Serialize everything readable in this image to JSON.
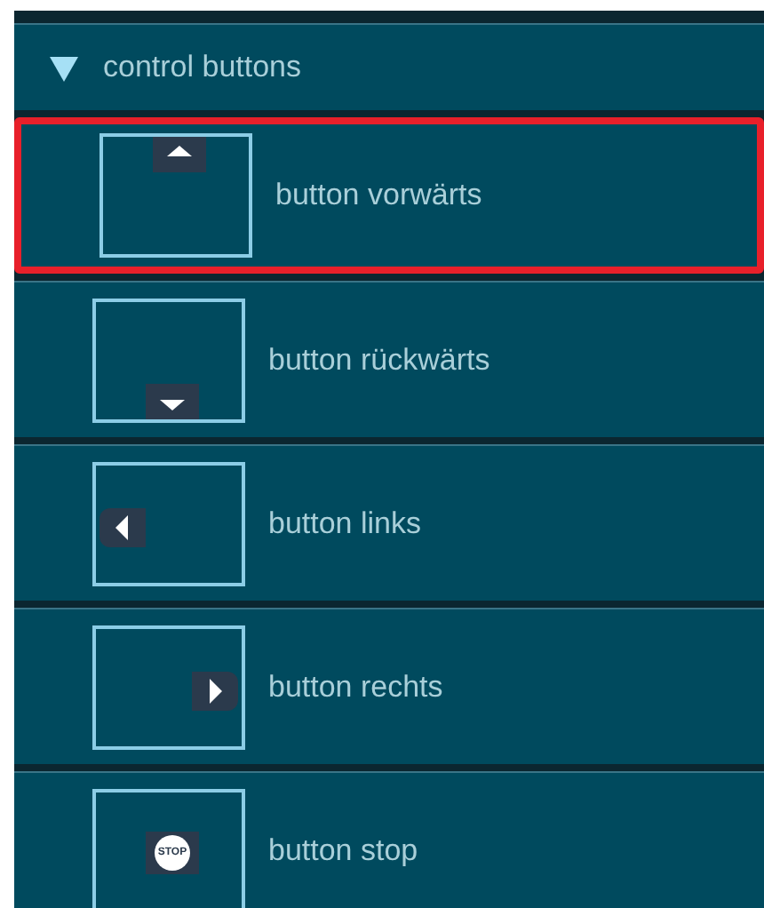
{
  "section": {
    "title": "control buttons",
    "expanded": true
  },
  "items": [
    {
      "kind": "up",
      "label": "button vorwärts",
      "selected": true
    },
    {
      "kind": "down",
      "label": "button rückwärts",
      "selected": false
    },
    {
      "kind": "left",
      "label": "button links",
      "selected": false
    },
    {
      "kind": "right",
      "label": "button rechts",
      "selected": false
    },
    {
      "kind": "stop",
      "label": "button stop",
      "selected": false,
      "icon_text": "STOP"
    }
  ]
}
